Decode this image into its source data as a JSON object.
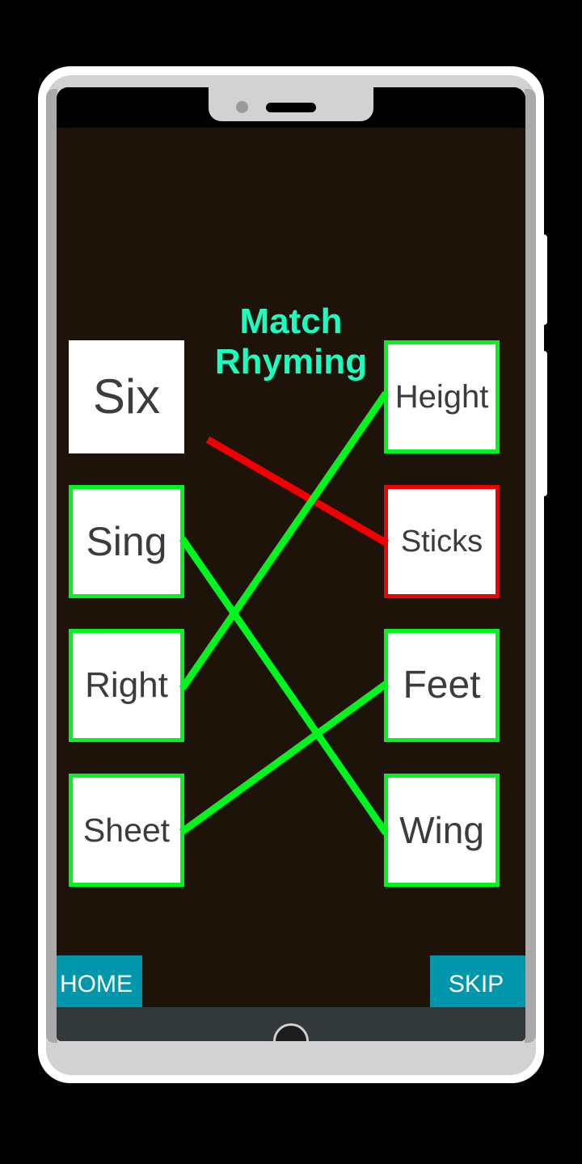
{
  "app": {
    "title": "Match\nRhyming",
    "title_color": "#1affc0",
    "background_color": "#1d1309"
  },
  "device": {
    "frame_color": "#ffffff",
    "bezel_color": "#d2d2d2",
    "screen_color": "#000000",
    "nav_bar_color": "#33383b",
    "notch_camera": "camera-dot",
    "notch_speaker": "speaker-grille",
    "side_buttons": [
      "volume-rocker",
      "power-button"
    ]
  },
  "left_column": [
    {
      "label": "Six",
      "border": "none",
      "border_color": "#ffffff",
      "matched": false
    },
    {
      "label": "Sing",
      "border": "green",
      "border_color": "#00f51e",
      "matched": true
    },
    {
      "label": "Right",
      "border": "green",
      "border_color": "#00f51e",
      "matched": true
    },
    {
      "label": "Sheet",
      "border": "green",
      "border_color": "#00f51e",
      "matched": true
    }
  ],
  "right_column": [
    {
      "label": "Height",
      "border": "green",
      "border_color": "#00f51e",
      "matched": true
    },
    {
      "label": "Sticks",
      "border": "red",
      "border_color": "#f20000",
      "matched": false
    },
    {
      "label": "Feet",
      "border": "green",
      "border_color": "#00f51e",
      "matched": true
    },
    {
      "label": "Wing",
      "border": "green",
      "border_color": "#00f51e",
      "matched": true
    }
  ],
  "connections": [
    {
      "from": "Six",
      "to": "Sticks",
      "color": "#f20000",
      "status": "incorrect"
    },
    {
      "from": "Sing",
      "to": "Wing",
      "color": "#00f51e",
      "status": "correct"
    },
    {
      "from": "Right",
      "to": "Height",
      "color": "#00f51e",
      "status": "correct"
    },
    {
      "from": "Sheet",
      "to": "Feet",
      "color": "#00f51e",
      "status": "correct"
    }
  ],
  "buttons": {
    "home_label": "HOME",
    "skip_label": "SKIP",
    "color": "#0097ad",
    "text_color": "#ffffff"
  }
}
